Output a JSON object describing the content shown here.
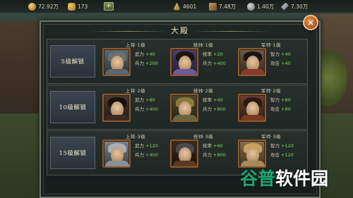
{
  "resources": {
    "coins": "72.92万",
    "ingots": "173",
    "grain": "4601",
    "wood": "7.48万",
    "stone": "1.40万",
    "iron": "7.30万"
  },
  "add_label": "+",
  "panel": {
    "title": "大殿",
    "close_label": "×"
  },
  "tiers": [
    {
      "label": "5级解锁",
      "slots": [
        {
          "head": "上将·1级",
          "stats": [
            {
              "name": "武力",
              "value": "+40"
            },
            {
              "name": "兵力",
              "value": "+200"
            }
          ]
        },
        {
          "head": "统帅·1级",
          "stats": [
            {
              "name": "统率",
              "value": "+20"
            },
            {
              "name": "兵力",
              "value": "+400"
            }
          ]
        },
        {
          "head": "军师·1级",
          "stats": [
            {
              "name": "智力",
              "value": "+40"
            },
            {
              "name": "攻击",
              "value": "+40"
            }
          ]
        }
      ]
    },
    {
      "label": "10级解锁",
      "slots": [
        {
          "head": "上将·2级",
          "stats": [
            {
              "name": "武力",
              "value": "+80"
            },
            {
              "name": "兵力",
              "value": "+400"
            }
          ]
        },
        {
          "head": "统帅·2级",
          "stats": [
            {
              "name": "统率",
              "value": "+40"
            },
            {
              "name": "兵力",
              "value": "+800"
            }
          ]
        },
        {
          "head": "军师·2级",
          "stats": [
            {
              "name": "智力",
              "value": "+80"
            },
            {
              "name": "攻击",
              "value": "+80"
            }
          ]
        }
      ]
    },
    {
      "label": "15级解锁",
      "slots": [
        {
          "head": "上将·3级",
          "stats": [
            {
              "name": "武力",
              "value": "+120"
            },
            {
              "name": "兵力",
              "value": "+400"
            }
          ]
        },
        {
          "head": "统帅·3级",
          "stats": [
            {
              "name": "统率",
              "value": "+60"
            },
            {
              "name": "兵力",
              "value": "+800"
            }
          ]
        },
        {
          "head": "军师·3级",
          "stats": [
            {
              "name": "智力",
              "value": "+120"
            },
            {
              "name": "攻击",
              "value": "+120"
            }
          ]
        }
      ]
    }
  ],
  "watermark": {
    "part1": "谷普",
    "part2": "软件园"
  },
  "colors": {
    "accent_green": "#7ed957",
    "close_button": "#c8602c",
    "watermark_green": "#19a974"
  }
}
